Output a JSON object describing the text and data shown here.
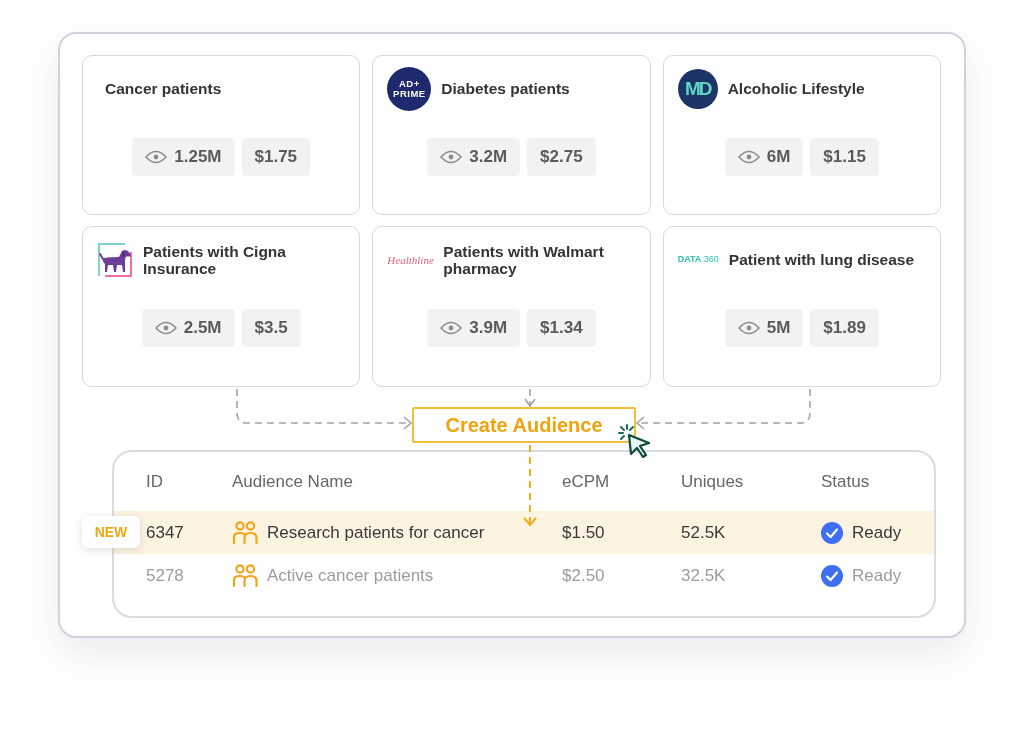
{
  "cards": [
    {
      "title": "Cancer patients",
      "reach": "1.25M",
      "price": "$1.75"
    },
    {
      "title": "Diabetes patients",
      "logo": {
        "kind": "circle",
        "text": "AD+ PRIME"
      },
      "reach": "3.2M",
      "price": "$2.75"
    },
    {
      "title": "Alcoholic Lifestyle",
      "logo": {
        "kind": "monogram",
        "text": "MD"
      },
      "reach": "6M",
      "price": "$1.15"
    },
    {
      "title": "Patients with Cigna Insurance",
      "logo": {
        "kind": "dog"
      },
      "reach": "2.5M",
      "price": "$3.5"
    },
    {
      "title": "Patients with Walmart pharmacy",
      "logo": {
        "kind": "script",
        "text": "Healthline"
      },
      "reach": "3.9M",
      "price": "$1.34"
    },
    {
      "title": "Patient with lung disease",
      "logo": {
        "kind": "wordmark",
        "text": "**DATA** 360"
      },
      "reach": "5M",
      "price": "$1.89"
    }
  ],
  "create_button": {
    "label": "Create Audience"
  },
  "table": {
    "columns": [
      "ID",
      "Audience Name",
      "eCPM",
      "Uniques",
      "Status"
    ],
    "rows": [
      {
        "id": "6347",
        "name": "Research patients for cancer",
        "ecpm": "$1.50",
        "uniques": "52.5K",
        "status": "Ready",
        "highlighted": true,
        "badge": "NEW"
      },
      {
        "id": "5278",
        "name": "Active cancer patients",
        "ecpm": "$2.50",
        "uniques": "32.5K",
        "status": "Ready",
        "highlighted": false
      }
    ]
  }
}
